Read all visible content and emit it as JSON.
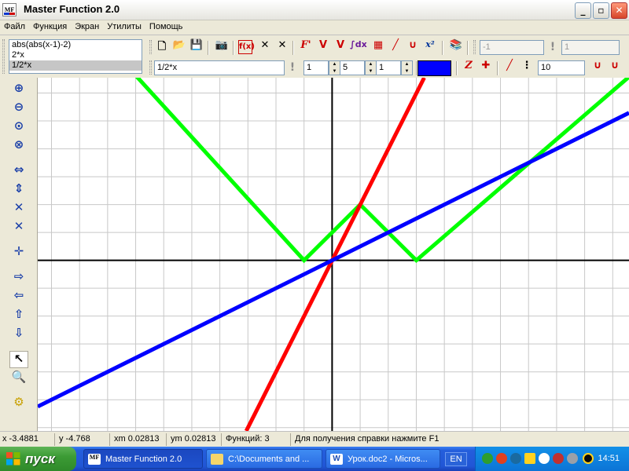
{
  "window": {
    "title": "Master Function 2.0",
    "icon_text": "MF"
  },
  "window_controls": {
    "minimize": "_",
    "maximize": "▫",
    "close": "✕"
  },
  "menu": [
    "Файл",
    "Функция",
    "Экран",
    "Утилиты",
    "Помощь"
  ],
  "functions": {
    "items": [
      "abs(abs(x-1)-2)",
      "2*x",
      "1/2*x"
    ],
    "selected_index": 2
  },
  "toolbar1": {
    "icons": [
      "new-file-icon",
      "open-folder-icon",
      "save-icon",
      "camera-icon",
      "fx-icon",
      "delete-icon",
      "delete-all-icon",
      "derivative-icon",
      "v-shape-icon",
      "v-shape-2-icon",
      "integral-icon",
      "table-icon",
      "line-icon",
      "parabola-icon",
      "square-icon",
      "book-icon"
    ],
    "labels": {
      "derivative": "F'",
      "integral": "∫dx",
      "square": "x²"
    },
    "param_a": "-1",
    "param_b": "1"
  },
  "toolbar2": {
    "expression": "1/2*x",
    "spin1": "1",
    "spin2": "5",
    "spin3": "1",
    "line_color": "#0000ff",
    "z_label": "Z",
    "point_value": "10"
  },
  "left_tools": [
    "zoom-in-icon",
    "zoom-out-icon",
    "zoom-reset-icon",
    "zoom-fit-icon",
    "shrink-horizontal-icon",
    "shrink-vertical-icon",
    "expand-horizontal-icon",
    "expand-vertical-icon",
    "center-origin-icon",
    "move-right-icon",
    "move-left-icon",
    "move-up-icon",
    "move-down-icon",
    "pointer-icon",
    "magnifier-icon",
    "settings-gear-icon"
  ],
  "chart_data": {
    "type": "line",
    "title": "",
    "xlabel": "",
    "ylabel": "",
    "xlim": [
      -10.49,
      10.58
    ],
    "ylim": [
      -6.12,
      6.55
    ],
    "grid": true,
    "grid_step": 1,
    "series": [
      {
        "function": "abs(abs(x-1)-2)",
        "color": "#00ff00",
        "x": [
          -10.49,
          -1,
          1,
          3,
          10.58
        ],
        "y": [
          10.49,
          0,
          2,
          0,
          6.58
        ]
      },
      {
        "function": "2*x",
        "color": "#ff0000",
        "x": [
          -3.06,
          3.28
        ],
        "y": [
          -6.12,
          6.55
        ]
      },
      {
        "function": "1/2*x",
        "color": "#0000ff",
        "x": [
          -10.49,
          10.58
        ],
        "y": [
          -5.245,
          5.29
        ]
      }
    ]
  },
  "status": {
    "x": "x -3.4881",
    "y": "y -4.768",
    "xm": "xm 0.02813",
    "ym": "ym 0.02813",
    "count": "Функций: 3",
    "hint": "Для получения справки нажмите F1"
  },
  "taskbar": {
    "start_label": "пуск",
    "tasks": [
      {
        "label": "Master Function 2.0",
        "icon": "MF",
        "active": true
      },
      {
        "label": "C:\\Documents and ...",
        "icon": "folder",
        "active": false
      },
      {
        "label": "Урок.doc2 - Micros...",
        "icon": "W",
        "active": false
      }
    ],
    "language": "EN",
    "clock": "14:51"
  }
}
